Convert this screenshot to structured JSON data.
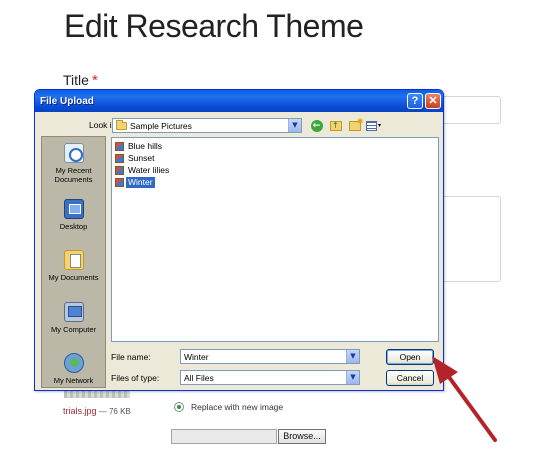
{
  "page": {
    "title": "Edit Research Theme",
    "title_field_label": "Title",
    "required_marker": "*",
    "attachment": {
      "filename": "trials.jpg",
      "size": "— 76 KB"
    },
    "replace_option": "Replace with new image",
    "browse_label": "Browse..."
  },
  "dialog": {
    "title": "File Upload",
    "help_glyph": "?",
    "close_glyph": "✕",
    "look_in_label": "Look in:",
    "look_in_value": "Sample Pictures",
    "places": [
      {
        "label": "My Recent Documents",
        "icon": "recent-documents-icon"
      },
      {
        "label": "Desktop",
        "icon": "desktop-icon"
      },
      {
        "label": "My Documents",
        "icon": "my-documents-icon"
      },
      {
        "label": "My Computer",
        "icon": "my-computer-icon"
      },
      {
        "label": "My Network",
        "icon": "my-network-icon"
      }
    ],
    "files": [
      "Blue hills",
      "Sunset",
      "Water lilies",
      "Winter"
    ],
    "selected_file": "Winter",
    "file_name_label": "File name:",
    "file_name_value": "Winter",
    "file_type_label": "Files of type:",
    "file_type_value": "All Files",
    "open_label": "Open",
    "cancel_label": "Cancel"
  },
  "colors": {
    "titlebar": "#0a5fe6",
    "selection": "#316ac5",
    "annotation_arrow": "#b3232a",
    "required": "#d8232a"
  }
}
